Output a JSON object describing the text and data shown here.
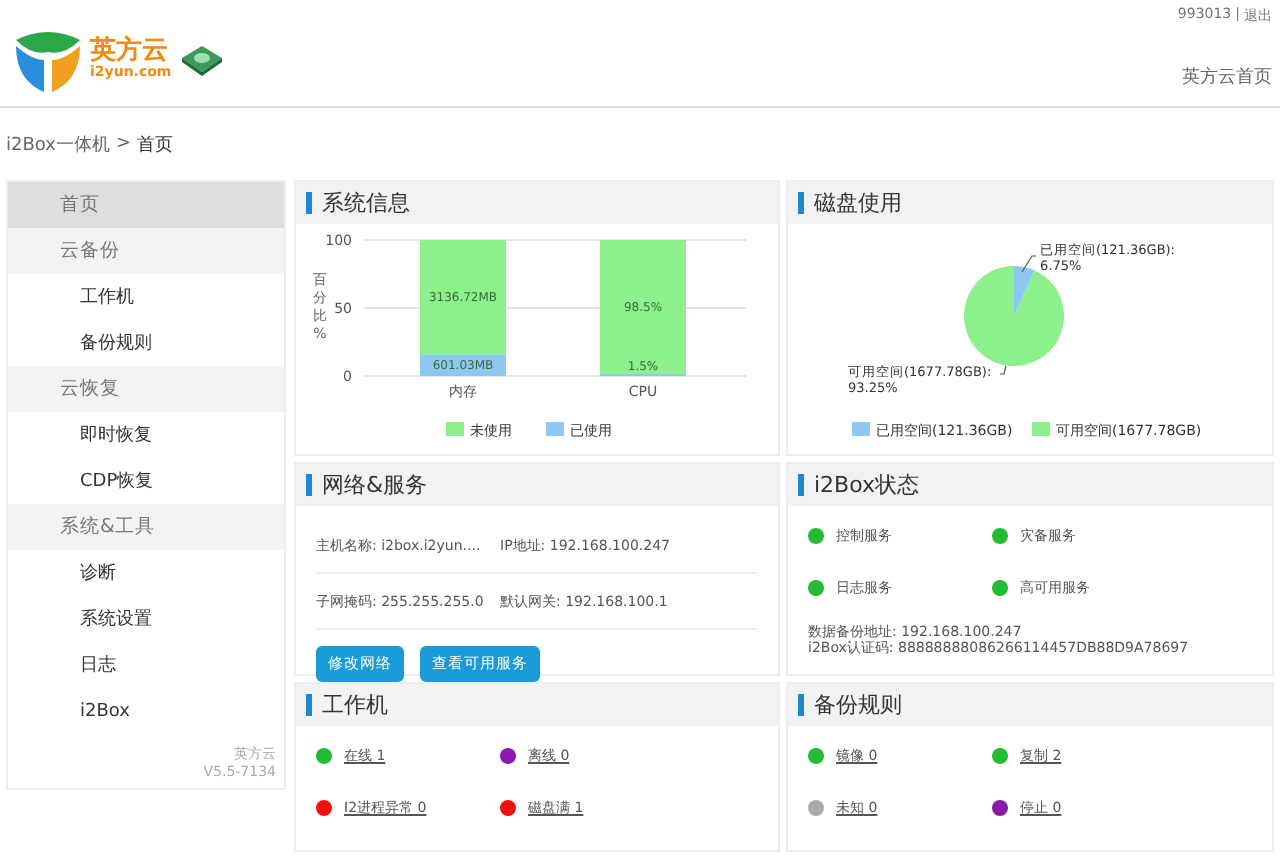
{
  "header": {
    "user": "993013",
    "separator": "|",
    "logout": "退出",
    "logo_name": "英方云",
    "logo_domain": "i2yun.com",
    "home_link": "英方云首页"
  },
  "breadcrumb": {
    "path": "i2Box一体机",
    "separator": ">",
    "current": "首页"
  },
  "sidebar": {
    "items": [
      {
        "label": "首页",
        "selected": true
      },
      {
        "label": "云备份",
        "selected": false,
        "children": [
          {
            "label": "工作机",
            "selected": false
          },
          {
            "label": "备份规则",
            "selected": false
          }
        ]
      },
      {
        "label": "云恢复",
        "selected": false,
        "children": [
          {
            "label": "即时恢复",
            "selected": false
          },
          {
            "label": "CDP恢复",
            "selected": false
          }
        ]
      },
      {
        "label": "系统&工具",
        "selected": false,
        "children": [
          {
            "label": "诊断",
            "selected": false
          },
          {
            "label": "系统设置",
            "selected": false
          },
          {
            "label": "日志",
            "selected": false
          },
          {
            "label": "i2Box",
            "selected": false
          }
        ]
      }
    ],
    "brand": "英方云",
    "version": "V5.5-7134"
  },
  "system_info": {
    "title": "系统信息",
    "chart_data": {
      "type": "bar",
      "ylabel": "百分比%",
      "categories": [
        "内存",
        "CPU"
      ],
      "stacked": true,
      "ylim": [
        0,
        100
      ],
      "yticks": [
        0,
        50,
        100
      ],
      "series": [
        {
          "name": "已使用",
          "color": "#8cc8f0",
          "values": [
            16,
            1.5
          ]
        },
        {
          "name": "未使用",
          "color": "#8cf08c",
          "values": [
            84,
            98.5
          ]
        }
      ],
      "value_labels": [
        [
          "601.03MB",
          "1.5%"
        ],
        [
          "3136.72MB",
          "98.5%"
        ]
      ],
      "legend": true
    }
  },
  "disk_usage": {
    "title": "磁盘使用",
    "chart_data": {
      "type": "pie",
      "categories": [
        "已用空间(121.36GB)",
        "可用空间(1677.78GB)"
      ],
      "values": [
        6.75,
        93.25
      ],
      "colors": [
        "#8cc8f0",
        "#8cf08c"
      ],
      "value_labels": [
        [
          "已用空间(121.36GB):",
          "6.75%"
        ],
        [
          "可用空间(1677.78GB):",
          "93.25%"
        ]
      ],
      "legend": true
    }
  },
  "network": {
    "title": "网络&服务",
    "fields": [
      [
        "主机名称: i2box.i2yun....",
        "IP地址: 192.168.100.247"
      ],
      [
        "子网掩码: 255.255.255.0",
        "默认网关: 192.168.100.1"
      ]
    ],
    "buttons": [
      "修改网络",
      "查看可用服务"
    ]
  },
  "i2box_status": {
    "title": "i2Box状态",
    "services": [
      {
        "label": "控制服务",
        "color": "#22bb33"
      },
      {
        "label": "灾备服务",
        "color": "#22bb33"
      },
      {
        "label": "日志服务",
        "color": "#22bb33"
      },
      {
        "label": "高可用服务",
        "color": "#22bb33"
      }
    ],
    "lines": [
      "数据备份地址: 192.168.100.247",
      "i2Box认证码: 88888888086266114457DB88D9A78697"
    ]
  },
  "workstations": {
    "title": "工作机",
    "items": [
      {
        "label": "在线 1",
        "color": "#22bb33"
      },
      {
        "label": "离线 0",
        "color": "#8a1aaa"
      },
      {
        "label": "I2进程异常 0",
        "color": "#ee1111"
      },
      {
        "label": "磁盘满 1",
        "color": "#ee1111"
      }
    ]
  },
  "backup_rules": {
    "title": "备份规则",
    "items": [
      {
        "label": "镜像 0",
        "color": "#22bb33"
      },
      {
        "label": "复制 2",
        "color": "#22bb33"
      },
      {
        "label": "未知 0",
        "color": "#aaaaaa"
      },
      {
        "label": "停止 0",
        "color": "#8a1aaa"
      }
    ]
  }
}
